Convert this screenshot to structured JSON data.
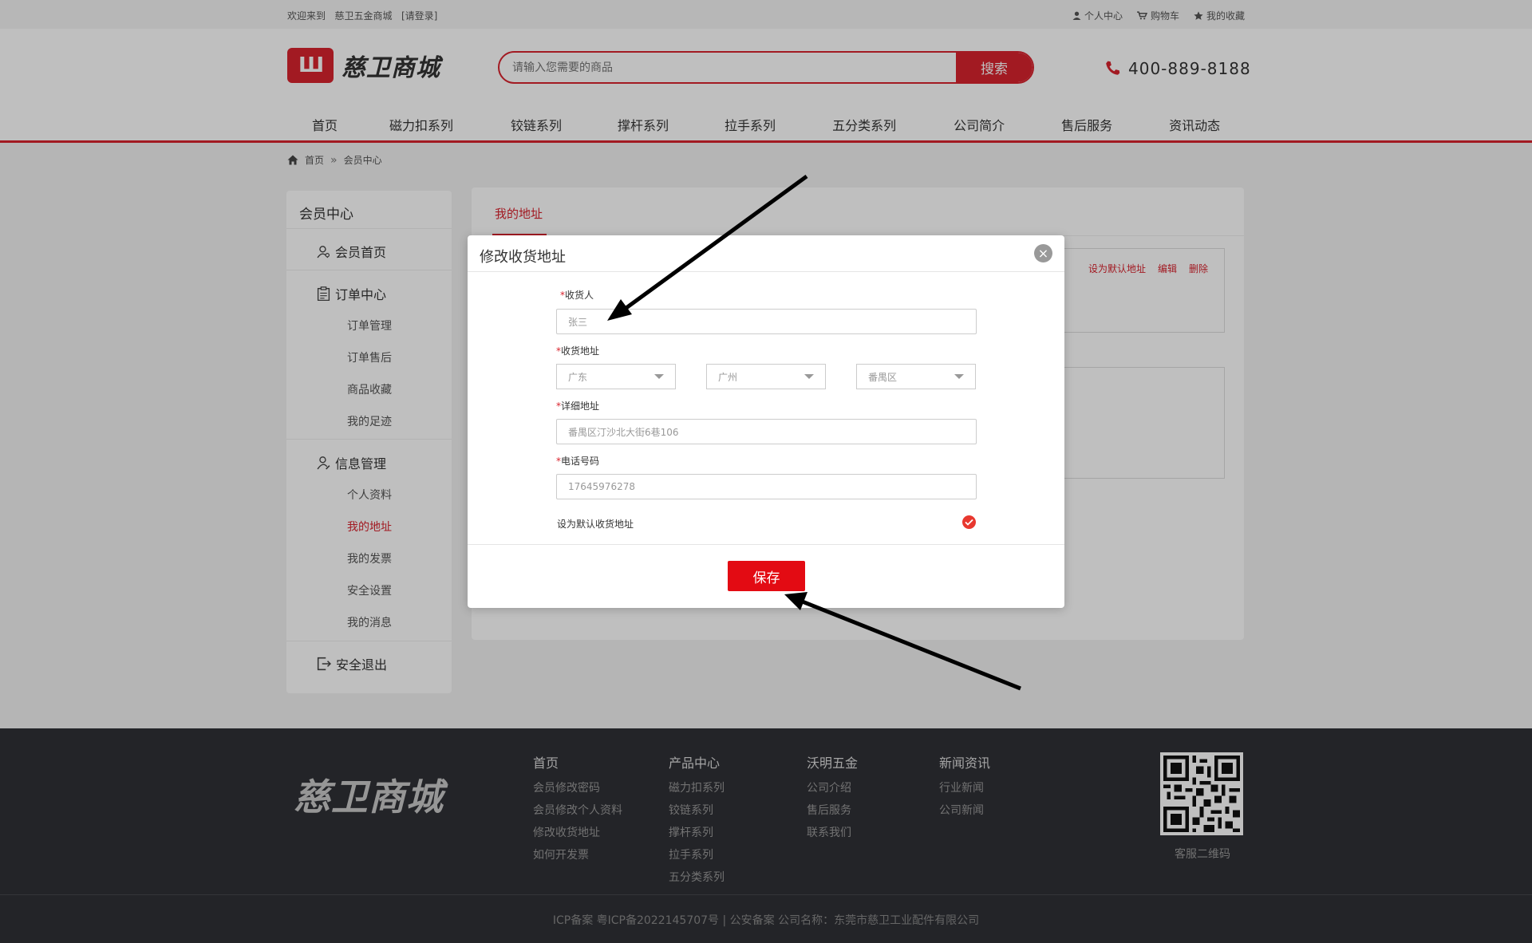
{
  "topbar": {
    "welcome": "欢迎来到",
    "shop": "慈卫五金商城",
    "login": "[请登录]",
    "personal": "个人中心",
    "cart": "购物车",
    "favorites": "我的收藏"
  },
  "header": {
    "logo_mark": "Ш",
    "logo_text": "慈卫商城",
    "search_placeholder": "请输入您需要的商品",
    "search_button": "搜索",
    "phone": "400-889-8188"
  },
  "nav": [
    "首页",
    "磁力扣系列",
    "铰链系列",
    "撑杆系列",
    "拉手系列",
    "五分类系列",
    "公司简介",
    "售后服务",
    "资讯动态"
  ],
  "breadcrumb": {
    "home": "首页",
    "current": "会员中心"
  },
  "sidebar": {
    "title": "会员中心",
    "member_home": "会员首页",
    "order_center": "订单中心",
    "order_items": [
      "订单管理",
      "订单售后",
      "商品收藏",
      "我的足迹"
    ],
    "info_mgmt": "信息管理",
    "info_items": [
      "个人资料",
      "我的地址",
      "我的发票",
      "安全设置",
      "我的消息"
    ],
    "logout": "安全退出"
  },
  "content": {
    "tab": "我的地址",
    "actions": {
      "set_default": "设为默认地址",
      "edit": "编辑",
      "delete": "删除"
    }
  },
  "modal": {
    "title": "修改收货地址",
    "receiver_label": "收货人",
    "receiver_value": "张三",
    "address_label": "收货地址",
    "province": "广东",
    "city": "广州",
    "district": "番禺区",
    "detail_label": "详细地址",
    "detail_value": "番禺区汀沙北大街6巷106",
    "phone_label": "电话号码",
    "phone_value": "17645976278",
    "default_label": "设为默认收货地址",
    "default_checked": true,
    "save": "保存",
    "required_mark": "*"
  },
  "footer": {
    "logo": "慈卫商城",
    "cols": [
      {
        "head": "首页",
        "items": [
          "会员修改密码",
          "会员修改个人资料",
          "修改收货地址",
          "如何开发票"
        ]
      },
      {
        "head": "产品中心",
        "items": [
          "磁力扣系列",
          "铰链系列",
          "撑杆系列",
          "拉手系列",
          "五分类系列"
        ]
      },
      {
        "head": "沃明五金",
        "items": [
          "公司介绍",
          "售后服务",
          "联系我们"
        ]
      },
      {
        "head": "新闻资讯",
        "items": [
          "行业新闻",
          "公司新闻"
        ]
      }
    ],
    "qr_caption": "客服二维码",
    "copyright": "ICP备案 粤ICP备2022145707号 | 公安备案 公司名称：东莞市慈卫工业配件有限公司"
  },
  "colors": {
    "accent": "#d9232e",
    "footer_bg": "#2f3036",
    "overlay": "rgba(0,0,0,0.25)"
  }
}
